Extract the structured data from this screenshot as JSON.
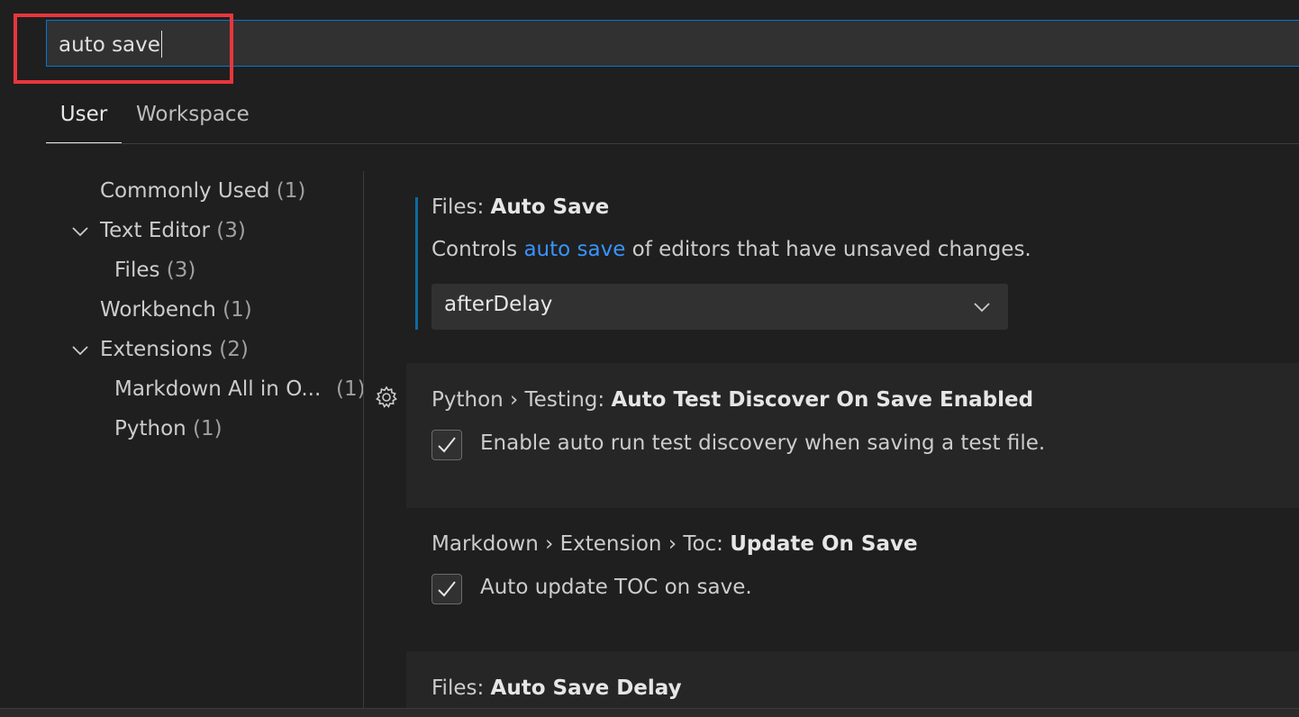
{
  "search": {
    "value": "auto save"
  },
  "tabs": [
    {
      "label": "User",
      "active": true
    },
    {
      "label": "Workspace",
      "active": false
    }
  ],
  "toc": [
    {
      "label": "Commonly Used",
      "count": "(1)"
    },
    {
      "label": "Text Editor",
      "count": "(3)",
      "expanded": true
    },
    {
      "label": "Files",
      "count": "(3)"
    },
    {
      "label": "Workbench",
      "count": "(1)"
    },
    {
      "label": "Extensions",
      "count": "(2)",
      "expanded": true
    },
    {
      "label": "Markdown All in O...",
      "count": "(1)"
    },
    {
      "label": "Python",
      "count": "(1)"
    }
  ],
  "settings": [
    {
      "category": "Files: ",
      "name": "Auto Save",
      "description_before": "Controls ",
      "description_link": "auto save",
      "description_after": " of editors that have unsaved changes.",
      "value": "afterDelay"
    },
    {
      "category": "Python › Testing: ",
      "name": "Auto Test Discover On Save Enabled",
      "checkbox_label": "Enable auto run test discovery when saving a test file.",
      "checked": true
    },
    {
      "category": "Markdown › Extension › Toc: ",
      "name": "Update On Save",
      "checkbox_label": "Auto update TOC on save.",
      "checked": true
    },
    {
      "category": "Files: ",
      "name": "Auto Save Delay"
    }
  ],
  "colors": {
    "accent": "#0078d4",
    "link": "#3794ff",
    "highlight": "#e8363c",
    "background": "#1f1f1f"
  }
}
